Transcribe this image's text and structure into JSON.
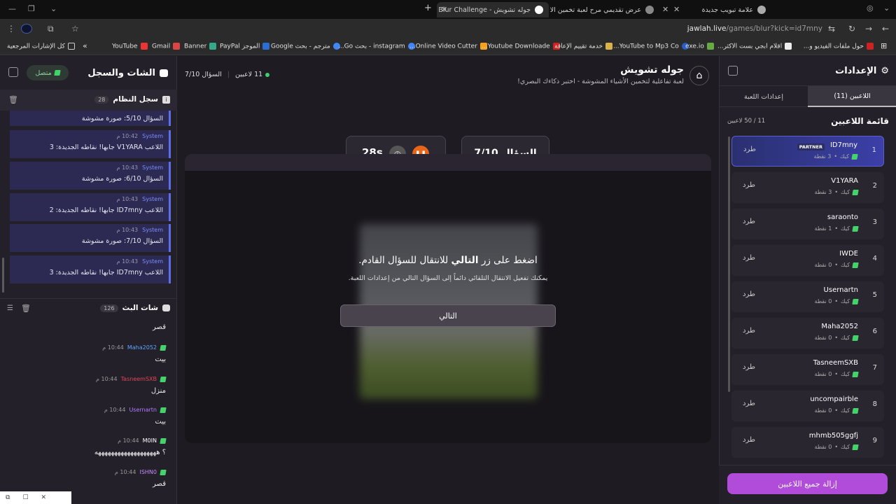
{
  "browser": {
    "tabs": [
      {
        "title": "جوله تشويش - Blur Challenge |"
      },
      {
        "title": "عرض تقديمي مرح لعبة تخمين الا"
      },
      {
        "title": "علامة تبويب جديدة"
      }
    ],
    "url_host": "jawlah.live",
    "url_path": "/games/blur?kick=id7mny",
    "bookmarks": [
      {
        "label": "كل الإشارات المرجعية"
      },
      {
        "label": "YouTube"
      },
      {
        "label": "Gmail"
      },
      {
        "label": "Banner"
      },
      {
        "label": "الموجز PayPal"
      },
      {
        "label": "مترجم - بحث Google"
      },
      {
        "label": "instagram - بحث Go..."
      },
      {
        "label": "Online Video Cutter..."
      },
      {
        "label": "Youtube Downloade..."
      },
      {
        "label": "خدمة تقييم الإعاقة"
      },
      {
        "label": "YouTube to Mp3 Co..."
      },
      {
        "label": "exe.io"
      },
      {
        "label": "اقلام ابجي بست الاكثر..."
      },
      {
        "label": "حول ملفات الفيديو و..."
      }
    ]
  },
  "left": {
    "title": "الشات والسجل",
    "status": "متصل",
    "system_log": {
      "title": "سجل النظام",
      "count": "28",
      "first_text": "السؤال 5/10: صورة مشوشة",
      "items": [
        {
          "author": "System",
          "time": "10:42 م",
          "text": "اللاعب V1YARA جابها! نقاطه الجديدة: 3"
        },
        {
          "author": "System",
          "time": "10:43 م",
          "text": "السؤال 6/10: صورة مشوشة"
        },
        {
          "author": "System",
          "time": "10:43 م",
          "text": "اللاعب ID7mny جابها! نقاطه الجديدة: 2"
        },
        {
          "author": "System",
          "time": "10:43 م",
          "text": "السؤال 7/10: صورة مشوشة"
        },
        {
          "author": "System",
          "time": "10:43 م",
          "text": "اللاعب ID7mny جابها! نقاطه الجديدة: 3"
        }
      ]
    },
    "stream_chat": {
      "title": "شات البث",
      "count": "126",
      "first_text": "قصر",
      "items": [
        {
          "author": "Maha2052",
          "time": "10:44 م",
          "text": "بيت",
          "color": "#5aa7ff"
        },
        {
          "author": "TasneemSXB",
          "time": "10:44 م",
          "text": "منزل",
          "color": "#e0455a"
        },
        {
          "author": "Usernartn",
          "time": "10:44 م",
          "text": "بيت",
          "color": "#b07cff"
        },
        {
          "author": "M0IN",
          "time": "10:44 م",
          "text": "؟ هههههههههههههههههههه",
          "color": "#ffffff"
        },
        {
          "author": "ISHN0",
          "time": "10:44 م",
          "text": "قصر",
          "color": "#c58cff"
        }
      ]
    }
  },
  "center": {
    "title": "جوله تشويش",
    "subtitle": "لعبة تفاعلية لتخمين الأشياء المشوشة - اختبر ذكاءك البصري!",
    "players_online": "11 لاعبين",
    "question_header": "السؤال 7/10",
    "question_box": "السؤال 7/10",
    "timer": "28s",
    "overlay": {
      "line1_pre": "اضغط على زر",
      "line1_bold": "التالي",
      "line1_post": "للانتقال للسؤال القادم.",
      "line2": "يمكنك تفعيل الانتقال التلقائي دائماً إلى السؤال التالي من إعدادات اللعبة.",
      "next_button": "التالي"
    }
  },
  "right": {
    "title": "الإعدادات",
    "tabs": [
      {
        "label": "اللاعبين (11)",
        "active": true
      },
      {
        "label": "إعدادات اللعبة",
        "active": false
      }
    ],
    "list_title": "قائمة اللاعبين",
    "capacity": "11 / 50 لاعبين",
    "kick_label": "طرد",
    "kick_badge": "كيك",
    "partner_badge": "PARTNER",
    "players": [
      {
        "rank": "1",
        "name": "ID7mny",
        "points": "3 نقطة",
        "partner": true
      },
      {
        "rank": "2",
        "name": "V1YARA",
        "points": "3 نقطة"
      },
      {
        "rank": "3",
        "name": "saraonto",
        "points": "1 نقطة"
      },
      {
        "rank": "4",
        "name": "IWDE",
        "points": "0 نقطة"
      },
      {
        "rank": "5",
        "name": "Usernartn",
        "points": "0 نقطة"
      },
      {
        "rank": "6",
        "name": "Maha2052",
        "points": "0 نقطة"
      },
      {
        "rank": "7",
        "name": "TasneemSXB",
        "points": "0 نقطة"
      },
      {
        "rank": "8",
        "name": "uncompairble",
        "points": "0 نقطة"
      },
      {
        "rank": "9",
        "name": "mhmb505ggfj",
        "points": "0 نقطة"
      }
    ],
    "remove_all": "إزالة جميع اللاعبين"
  },
  "colors": {
    "accent": "#e8661a",
    "purple": "#b04cd9",
    "kick_green": "#44d36a",
    "system_blue": "#5a6fe6"
  }
}
